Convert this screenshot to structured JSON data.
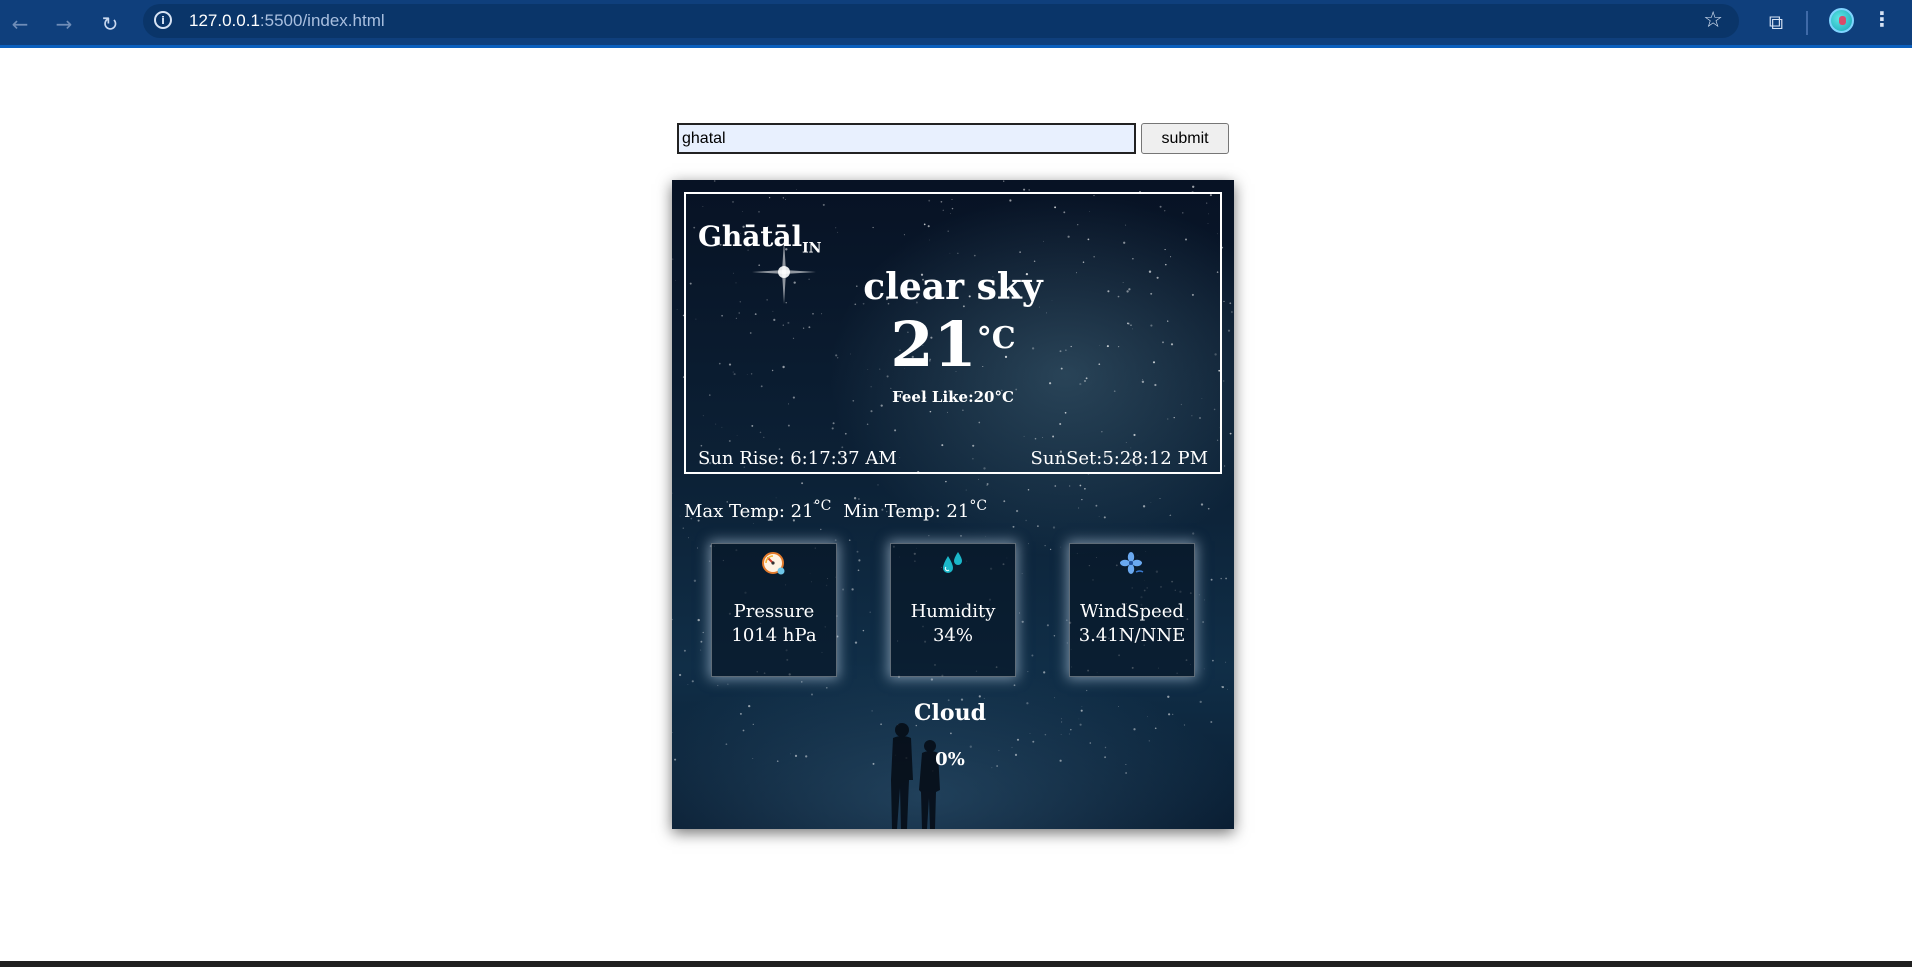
{
  "browser": {
    "url_host": "127.0.0.1",
    "url_rest": ":5500/index.html",
    "back_icon": "back-arrow-icon",
    "forward_icon": "forward-arrow-icon",
    "reload_icon": "reload-icon"
  },
  "search": {
    "value": "ghatal",
    "submit_label": "submit"
  },
  "weather": {
    "city": "Ghātāl",
    "country": "IN",
    "condition": "clear sky",
    "temperature": "21",
    "temp_unit": "°C",
    "feels_like": "Feel Like:20°C",
    "sunrise": "Sun Rise: 6:17:37 AM",
    "sunset": "SunSet:5:28:12 PM",
    "max_temp": "Max Temp: 21",
    "min_temp": "Min Temp: 21",
    "minmax_unit": "°C",
    "stats": [
      {
        "label": "Pressure",
        "value": "1014 hPa",
        "icon": "pressure-gauge-icon"
      },
      {
        "label": "Humidity",
        "value": "34%",
        "icon": "humidity-drops-icon"
      },
      {
        "label": "WindSpeed",
        "value": "3.41N/NNE",
        "icon": "wind-fan-icon"
      }
    ],
    "cloud_title": "Cloud",
    "cloud_value": "0%"
  },
  "colors": {
    "browser_chrome": "#0f3f7c",
    "card_background": "#0c2136",
    "text": "#ffffff"
  }
}
